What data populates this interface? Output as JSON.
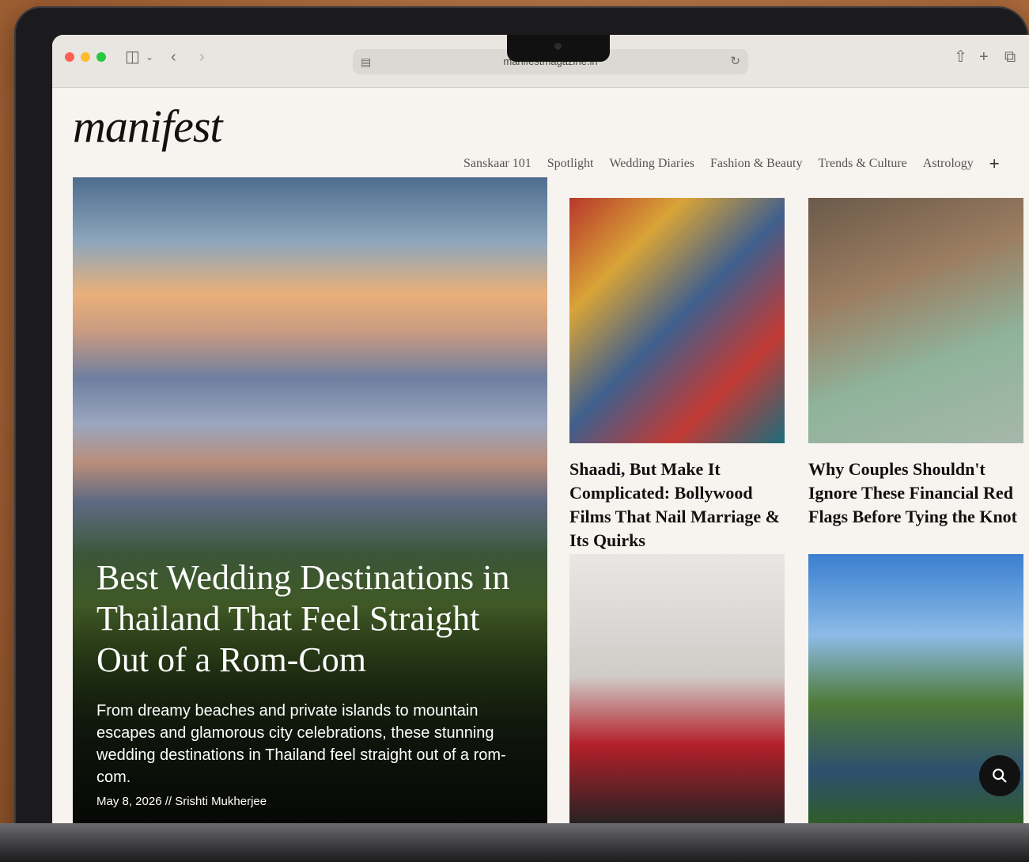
{
  "browser": {
    "url": "manifestmagazine.in",
    "icons": {
      "sidebar": "sidebar-icon",
      "back": "chevron-left-icon",
      "forward": "chevron-right-icon",
      "reload": "reload-icon",
      "share": "share-icon",
      "new_tab": "plus-icon",
      "tabs": "tabs-overview-icon"
    }
  },
  "site": {
    "logo": "manifest",
    "nav": [
      "Sanskaar 101",
      "Spotlight",
      "Wedding Diaries",
      "Fashion & Beauty",
      "Trends & Culture",
      "Astrology"
    ],
    "nav_more": "+"
  },
  "hero": {
    "title": "Best Wedding Destinations in Thailand That Feel Straight Out of a Rom-Com",
    "summary": "From dreamy beaches and private islands to mountain escapes and glamorous city celebrations, these stunning wedding destinations in Thailand feel straight out of a rom-com.",
    "meta": "May 8, 2026 // Srishti Mukherjee"
  },
  "cards": [
    {
      "title": "Shaadi, But Make It Complicated: Bollywood Films That Nail Marriage & Its Quirks"
    },
    {
      "title": "Why Couples Shouldn't Ignore These Financial Red Flags Before Tying the Knot"
    },
    {
      "title": ""
    },
    {
      "title": ""
    }
  ],
  "search": {
    "icon": "search-icon"
  }
}
